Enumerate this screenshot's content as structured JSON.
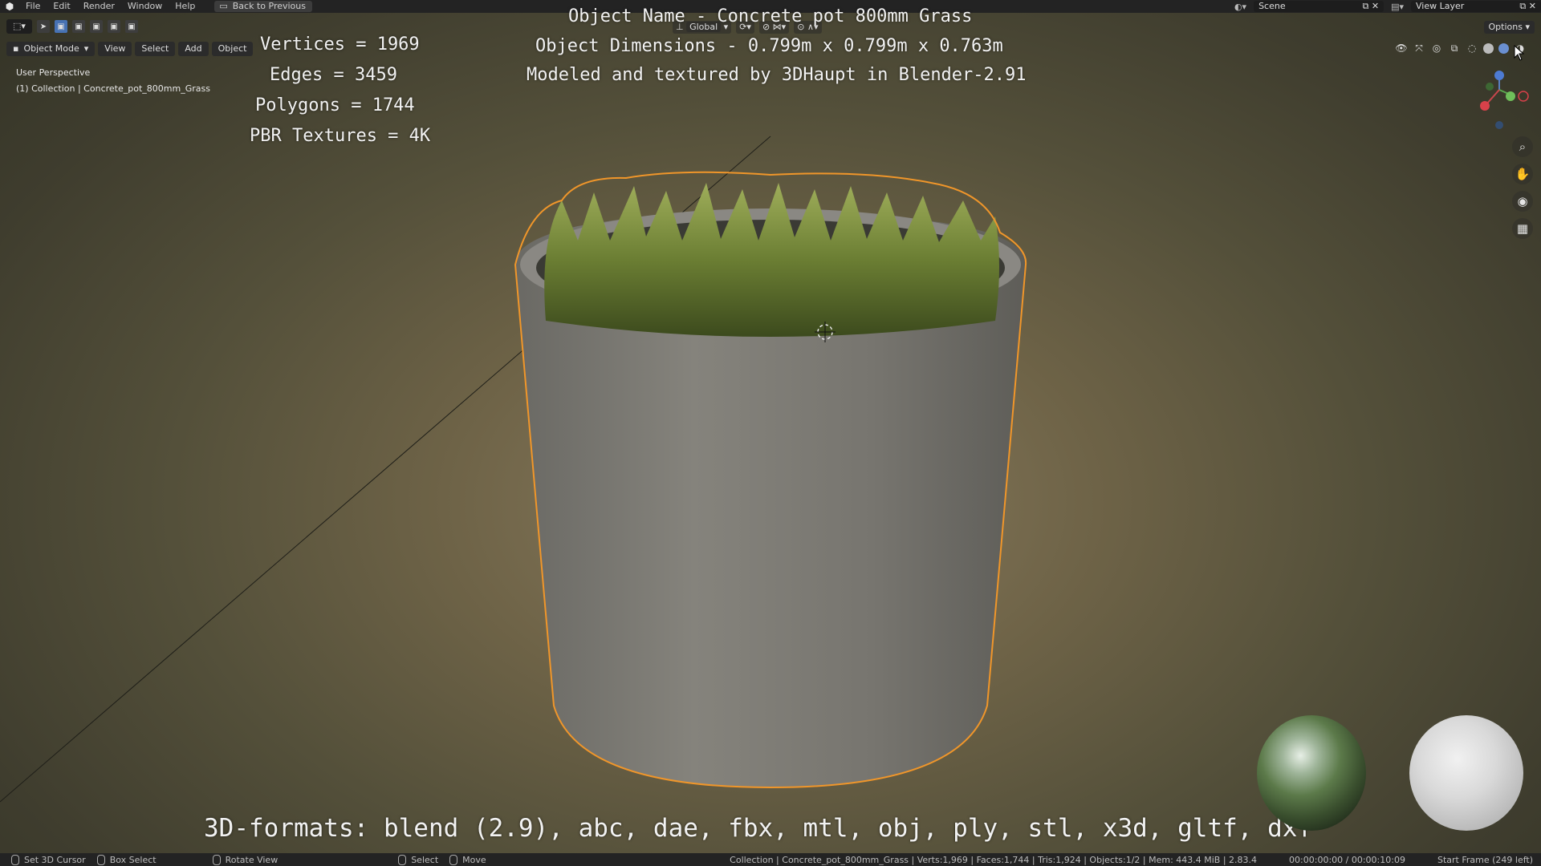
{
  "topbar": {
    "menus": [
      "File",
      "Edit",
      "Render",
      "Window",
      "Help"
    ],
    "back_label": "Back to Previous",
    "scene_label": "Scene",
    "view_layer_label": "View Layer"
  },
  "header": {
    "mode_label": "Object Mode",
    "menus": [
      "View",
      "Select",
      "Add",
      "Object"
    ],
    "orientation_label": "Global",
    "options_label": "Options"
  },
  "viewport": {
    "perspective_label": "User Perspective",
    "collection_label": "(1) Collection | Concrete_pot_800mm_Grass"
  },
  "overlay": {
    "vertices": "Vertices = 1969",
    "edges": "Edges = 3459",
    "polygons": "Polygons = 1744",
    "textures": "PBR Textures = 4K",
    "object_name": "Object Name - Concrete pot 800mm Grass",
    "dimensions": "Object Dimensions -  0.799m x 0.799m x 0.763m",
    "credits": "Modeled and textured by 3DHaupt in Blender-2.91",
    "formats": "3D-formats: blend (2.9), abc, dae, fbx, mtl, obj, ply, stl, x3d, gltf, dxf"
  },
  "statusbar": {
    "set_cursor": "Set 3D Cursor",
    "box_select": "Box Select",
    "rotate_view": "Rotate View",
    "select": "Select",
    "move": "Move",
    "scene_stats": "Collection | Concrete_pot_800mm_Grass | Verts:1,969 | Faces:1,744 | Tris:1,924 | Objects:1/2 | Mem: 443.4 MiB | 2.83.4",
    "timecode": "00:00:00:00 / 00:00:10:09",
    "start_frame": "Start Frame (249 left)"
  },
  "icons": {
    "app": "blender-icon",
    "nav": [
      "zoom-icon",
      "hand-pan-icon",
      "camera-icon",
      "grid-ortho-icon"
    ]
  },
  "colors": {
    "selection_outline": "#f0962a",
    "active_blue": "#4772b3"
  }
}
